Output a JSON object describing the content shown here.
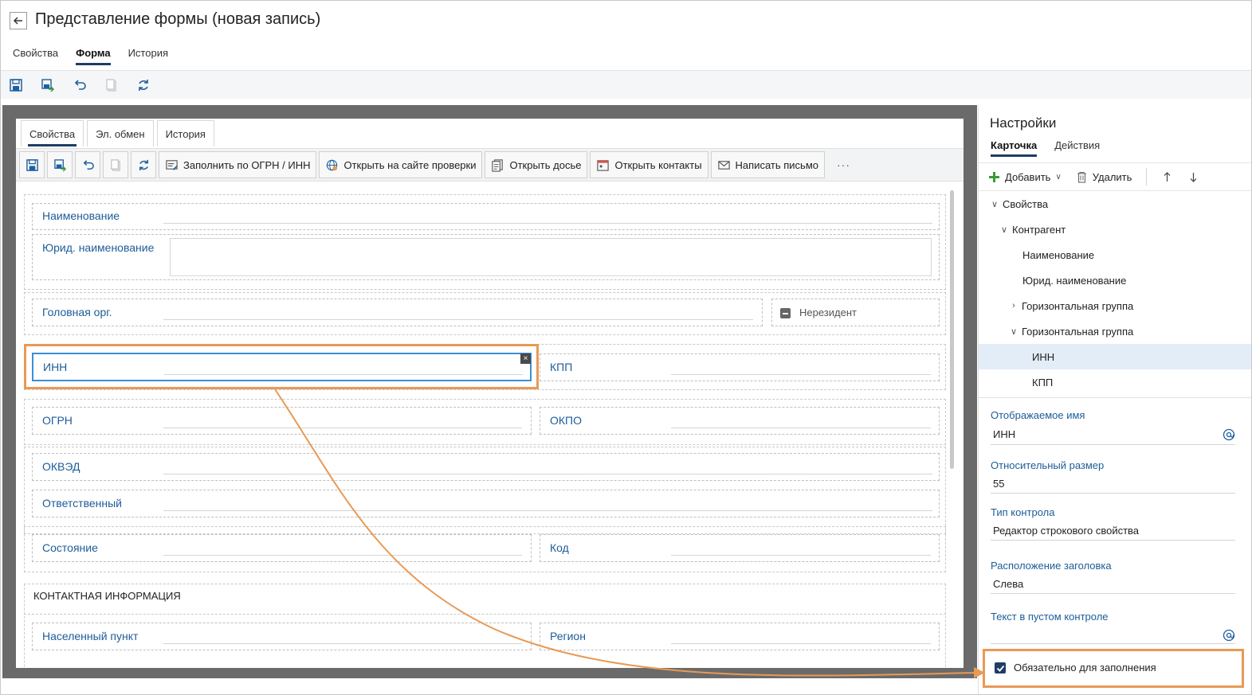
{
  "header": {
    "title": "Представление формы (новая запись)",
    "tabs": [
      {
        "label": "Свойства",
        "active": false
      },
      {
        "label": "Форма",
        "active": true
      },
      {
        "label": "История",
        "active": false
      }
    ]
  },
  "toolbar": {
    "icons": [
      "save-icon",
      "save-and-close-icon",
      "undo-icon",
      "copy-icon",
      "refresh-icon"
    ]
  },
  "form": {
    "tabs": [
      {
        "label": "Свойства",
        "active": true
      },
      {
        "label": "Эл. обмен",
        "active": false
      },
      {
        "label": "История",
        "active": false
      }
    ],
    "toolbar_buttons": [
      {
        "label": "Заполнить по ОГРН / ИНН",
        "icon": "fill-icon"
      },
      {
        "label": "Открыть на сайте проверки",
        "icon": "globe-icon"
      },
      {
        "label": "Открыть досье",
        "icon": "dossier-icon"
      },
      {
        "label": "Открыть контакты",
        "icon": "calendar-icon"
      },
      {
        "label": "Написать письмо",
        "icon": "mail-icon"
      }
    ],
    "more": "···",
    "fields": {
      "name": "Наименование",
      "legal_name": "Юрид. наименование",
      "head_org": "Головная орг.",
      "nonresident": "Нерезидент",
      "inn": "ИНН",
      "kpp": "КПП",
      "ogrn": "ОГРН",
      "okpo": "ОКПО",
      "okved": "ОКВЭД",
      "responsible": "Ответственный",
      "state": "Состояние",
      "code": "Код",
      "contact_section": "КОНТАКТНАЯ ИНФОРМАЦИЯ",
      "locality": "Населенный пункт",
      "region": "Регион"
    }
  },
  "panel": {
    "title": "Настройки",
    "tabs": [
      {
        "label": "Карточка",
        "active": true
      },
      {
        "label": "Действия",
        "active": false
      }
    ],
    "add_label": "Добавить",
    "delete_label": "Удалить",
    "tree": [
      {
        "label": "Свойства",
        "level": 0,
        "arrow": "expanded"
      },
      {
        "label": "Контрагент",
        "level": 1,
        "arrow": "expanded"
      },
      {
        "label": "Наименование",
        "level": 2,
        "arrow": "none"
      },
      {
        "label": "Юрид. наименование",
        "level": 2,
        "arrow": "none"
      },
      {
        "label": "Горизонтальная группа",
        "level": 2,
        "arrow": "collapsed"
      },
      {
        "label": "Горизонтальная группа",
        "level": 2,
        "arrow": "expanded"
      },
      {
        "label": "ИНН",
        "level": 3,
        "arrow": "none",
        "selected": true
      },
      {
        "label": "КПП",
        "level": 3,
        "arrow": "none"
      }
    ],
    "props": {
      "display_name_label": "Отображаемое имя",
      "display_name_value": "ИНН",
      "relative_size_label": "Относительный размер",
      "relative_size_value": "55",
      "control_type_label": "Тип контрола",
      "control_type_value": "Редактор строкового свойства",
      "caption_position_label": "Расположение заголовка",
      "caption_position_value": "Слева",
      "empty_text_label": "Текст в пустом контроле",
      "empty_text_value": ""
    },
    "required_label": "Обязательно для заполнения",
    "required_checked": true
  },
  "colors": {
    "accent": "#1f3d66",
    "label_blue": "#1d5c98",
    "highlight": "#e89a55",
    "canvas": "#6a6a6a"
  }
}
